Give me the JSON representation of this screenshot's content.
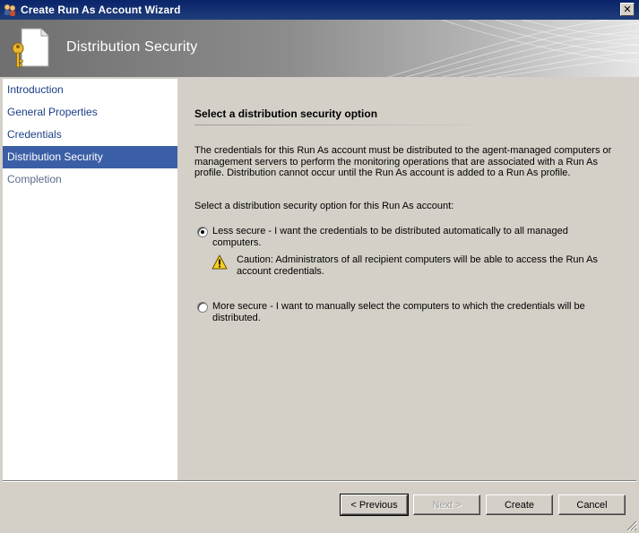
{
  "window": {
    "title": "Create Run As Account Wizard",
    "close_glyph": "✕"
  },
  "header": {
    "title": "Distribution Security",
    "icon": "document-key-icon"
  },
  "nav": {
    "items": [
      {
        "label": "Introduction",
        "state": "done"
      },
      {
        "label": "General Properties",
        "state": "done"
      },
      {
        "label": "Credentials",
        "state": "done"
      },
      {
        "label": "Distribution Security",
        "state": "selected"
      },
      {
        "label": "Completion",
        "state": "pending"
      }
    ]
  },
  "main": {
    "section_title": "Select a distribution security option",
    "description": "The credentials for this Run As account must be distributed to the agent-managed computers or management servers to perform the monitoring operations that are associated with a Run As profile. Distribution cannot occur until the Run As account is added to a Run As profile.",
    "prompt": "Select a distribution security option for this Run As account:",
    "options": [
      {
        "label": "Less secure - I want the credentials to be distributed automatically to all managed computers.",
        "checked": true
      },
      {
        "label": "More secure - I want to manually select the computers to which the credentials will be distributed.",
        "checked": false
      }
    ],
    "caution": "Caution: Administrators of all recipient computers will be able to access the Run As account credentials."
  },
  "buttons": {
    "previous": "< Previous",
    "next": "Next >",
    "create": "Create",
    "cancel": "Cancel"
  },
  "colors": {
    "title_bar": "#0a246a",
    "nav_selected": "#3b5fa6",
    "nav_text": "#1c3f86",
    "dialog_bg": "#d4d0c8"
  }
}
